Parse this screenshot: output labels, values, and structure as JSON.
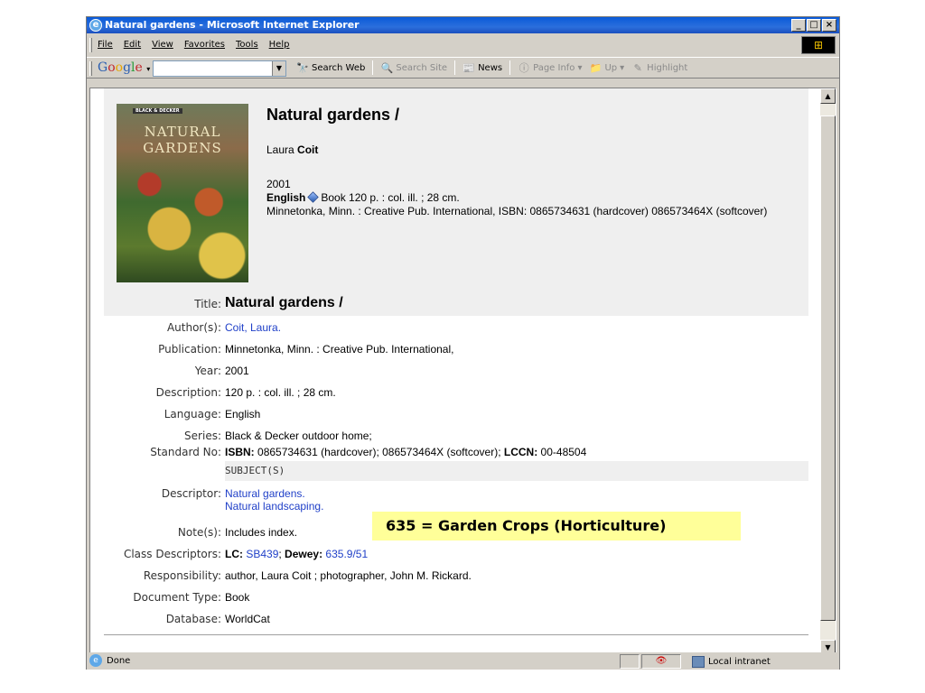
{
  "window": {
    "title": "Natural gardens - Microsoft Internet Explorer",
    "buttons": [
      "_",
      "□",
      "×"
    ]
  },
  "menu": [
    "File",
    "Edit",
    "View",
    "Favorites",
    "Tools",
    "Help"
  ],
  "google_toolbar": {
    "logo": "Google",
    "tools": [
      {
        "label": "Search Web",
        "icon": "binoculars-icon",
        "enabled": true
      },
      {
        "label": "Search Site",
        "icon": "site-search-icon",
        "enabled": false
      },
      {
        "label": "News",
        "icon": "news-icon",
        "enabled": true
      },
      {
        "label": "Page Info",
        "icon": "info-icon",
        "enabled": false
      },
      {
        "label": "Up",
        "icon": "folder-up-icon",
        "enabled": false
      },
      {
        "label": "Highlight",
        "icon": "highlighter-icon",
        "enabled": false
      }
    ]
  },
  "cover": {
    "brand": "BLACK & DECKER",
    "line1": "NATURAL",
    "line2": "GARDENS"
  },
  "summary": {
    "title": "Natural gardens /",
    "author_first": "Laura",
    "author_last": "Coit",
    "year": "2001",
    "language": "English",
    "format_desc": "Book 120 p. : col. ill. ; 28 cm.",
    "publication": "Minnetonka, Minn. : Creative Pub. International, ISBN: 0865734631 (hardcover) 086573464X (softcover)"
  },
  "fields": {
    "title_label": "Title:",
    "title_value": "Natural gardens /",
    "author_label": "Author(s):",
    "author_value": "Coit, Laura.",
    "publication_label": "Publication:",
    "publication_value": "Minnetonka, Minn. : Creative Pub. International,",
    "year_label": "Year:",
    "year_value": "2001",
    "description_label": "Description:",
    "description_value": "120 p. : col. ill. ; 28 cm.",
    "language_label": "Language:",
    "language_value": "English",
    "series_label": "Series:",
    "series_value": "Black & Decker outdoor home;",
    "stdno_label": "Standard No:",
    "stdno_isbn_label": "ISBN:",
    "stdno_isbn_value": "0865734631 (hardcover); 086573464X (softcover);",
    "stdno_lccn_label": "LCCN:",
    "stdno_lccn_value": "00-48504",
    "subjects_header": "SUBJECT(S)",
    "descriptor_label": "Descriptor:",
    "descriptor_values": [
      "Natural gardens.",
      "Natural landscaping."
    ],
    "notes_label": "Note(s):",
    "notes_value": "Includes index.",
    "class_label": "Class Descriptors:",
    "class_lc_label": "LC:",
    "class_lc_value": "SB439",
    "class_dewey_label": "Dewey:",
    "class_dewey_value": "635.9/51",
    "responsibility_label": "Responsibility:",
    "responsibility_value": "author, Laura Coit ; photographer, John M. Rickard.",
    "doctype_label": "Document Type:",
    "doctype_value": "Book",
    "database_label": "Database:",
    "database_value": "WorldCat"
  },
  "callout": "635 = Garden Crops (Horticulture)",
  "status": {
    "text": "Done",
    "zone": "Local intranet"
  },
  "colors": {
    "link": "#2040c8",
    "callout_bg": "#ffff99",
    "panel_bg": "#efefef"
  }
}
